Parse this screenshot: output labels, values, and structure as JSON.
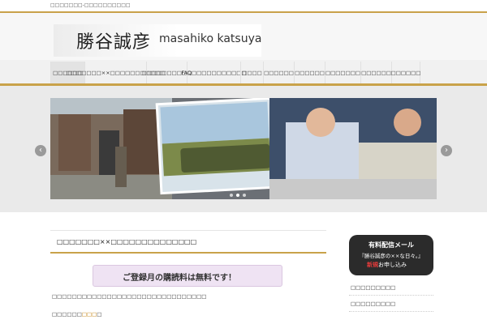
{
  "topbar": {
    "text": "□□□□□□□-□□□□□□□□□□"
  },
  "header": {
    "logo_jp": "勝谷誠彦",
    "logo_en": "masahiko katsuya"
  },
  "nav": {
    "items": [
      {
        "label": "□□□□□□"
      },
      {
        "label": "□□□□□□□××□□□□□□□□□□□"
      },
      {
        "label": "□□□□□□□□□□"
      },
      {
        "label": "FAQ□□□□□□□□□□□"
      },
      {
        "label": "□□□□"
      },
      {
        "label": "□□□□□□"
      },
      {
        "label": "□□□□□□"
      },
      {
        "label": "□□□□□□□"
      },
      {
        "label": "□□□□□□"
      },
      {
        "label": "□□□□□□"
      }
    ]
  },
  "slider": {
    "prev": "‹",
    "next": "›",
    "dots": 3,
    "active_dot": 1
  },
  "post": {
    "title": "□□□□□□□××□□□□□□□□□□□□□□",
    "banner": "ご登録月の購読料は無料です！",
    "line1": "□□□□□□□□□□□□□□□□□□□□□□□□□□□□□□□",
    "line2_a": "□□□□□□",
    "line2_b": "□□□",
    "line2_c": "□"
  },
  "sidebar": {
    "ad_line1": "有料配信メール",
    "ad_line2": "『勝谷誠彦の××な日々。』",
    "ad_new": "新規",
    "ad_line3": "お申し込み",
    "links": [
      {
        "label": "□□□□□□□□□"
      },
      {
        "label": "□□□□□□□□□"
      }
    ]
  },
  "colors": {
    "accent": "#c9a24a",
    "nav_bg": "#f1f1f1",
    "banner_bg": "#efe3f3",
    "ad_bg": "#2b2b2b"
  }
}
